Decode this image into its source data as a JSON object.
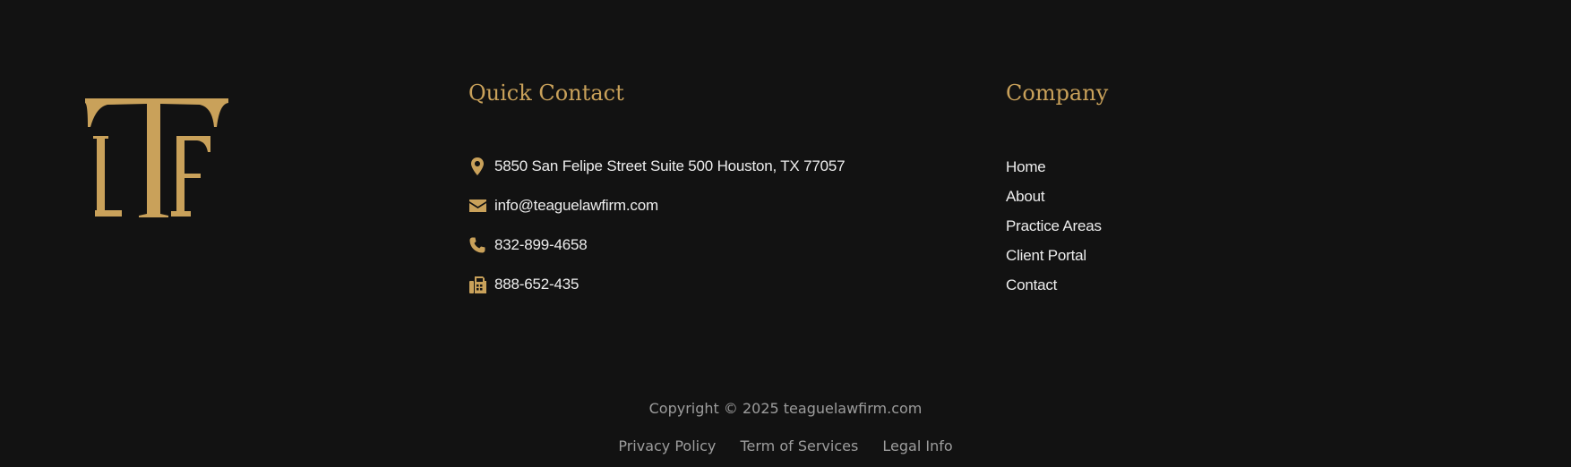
{
  "brand": {
    "logo_text": "LTF",
    "logo_color": "#c9a15a"
  },
  "colors": {
    "background": "#121212",
    "accent": "#c9a15a",
    "text": "#ededed",
    "muted": "#9d9d9d"
  },
  "quick_contact": {
    "title": "Quick Contact",
    "items": [
      {
        "icon": "map-pin-icon",
        "text": "5850 San Felipe Street Suite 500 Houston, TX 77057"
      },
      {
        "icon": "envelope-icon",
        "text": "info@teaguelawfirm.com"
      },
      {
        "icon": "phone-icon",
        "text": "832-899-4658"
      },
      {
        "icon": "fax-icon",
        "text": "888-652-435"
      }
    ]
  },
  "company": {
    "title": "Company",
    "links": [
      {
        "label": "Home"
      },
      {
        "label": "About"
      },
      {
        "label": "Practice Areas"
      },
      {
        "label": "Client Portal"
      },
      {
        "label": "Contact"
      }
    ]
  },
  "bottom": {
    "copyright": "Copyright © 2025 teaguelawfirm.com",
    "links": [
      {
        "label": "Privacy Policy"
      },
      {
        "label": "Term of Services"
      },
      {
        "label": "Legal Info"
      }
    ]
  }
}
